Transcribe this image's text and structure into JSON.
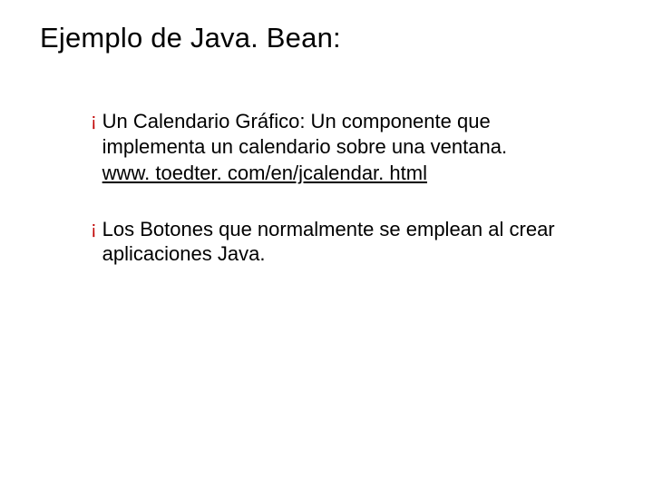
{
  "title": "Ejemplo de Java. Bean:",
  "bullets": [
    {
      "marker": "¡",
      "text": "Un Calendario Gráfico: Un componente que implementa un calendario sobre una ventana.",
      "link": "www. toedter. com/en/jcalendar. html"
    },
    {
      "marker": "¡",
      "text": "Los Botones que normalmente se emplean al crear aplicaciones Java."
    }
  ]
}
